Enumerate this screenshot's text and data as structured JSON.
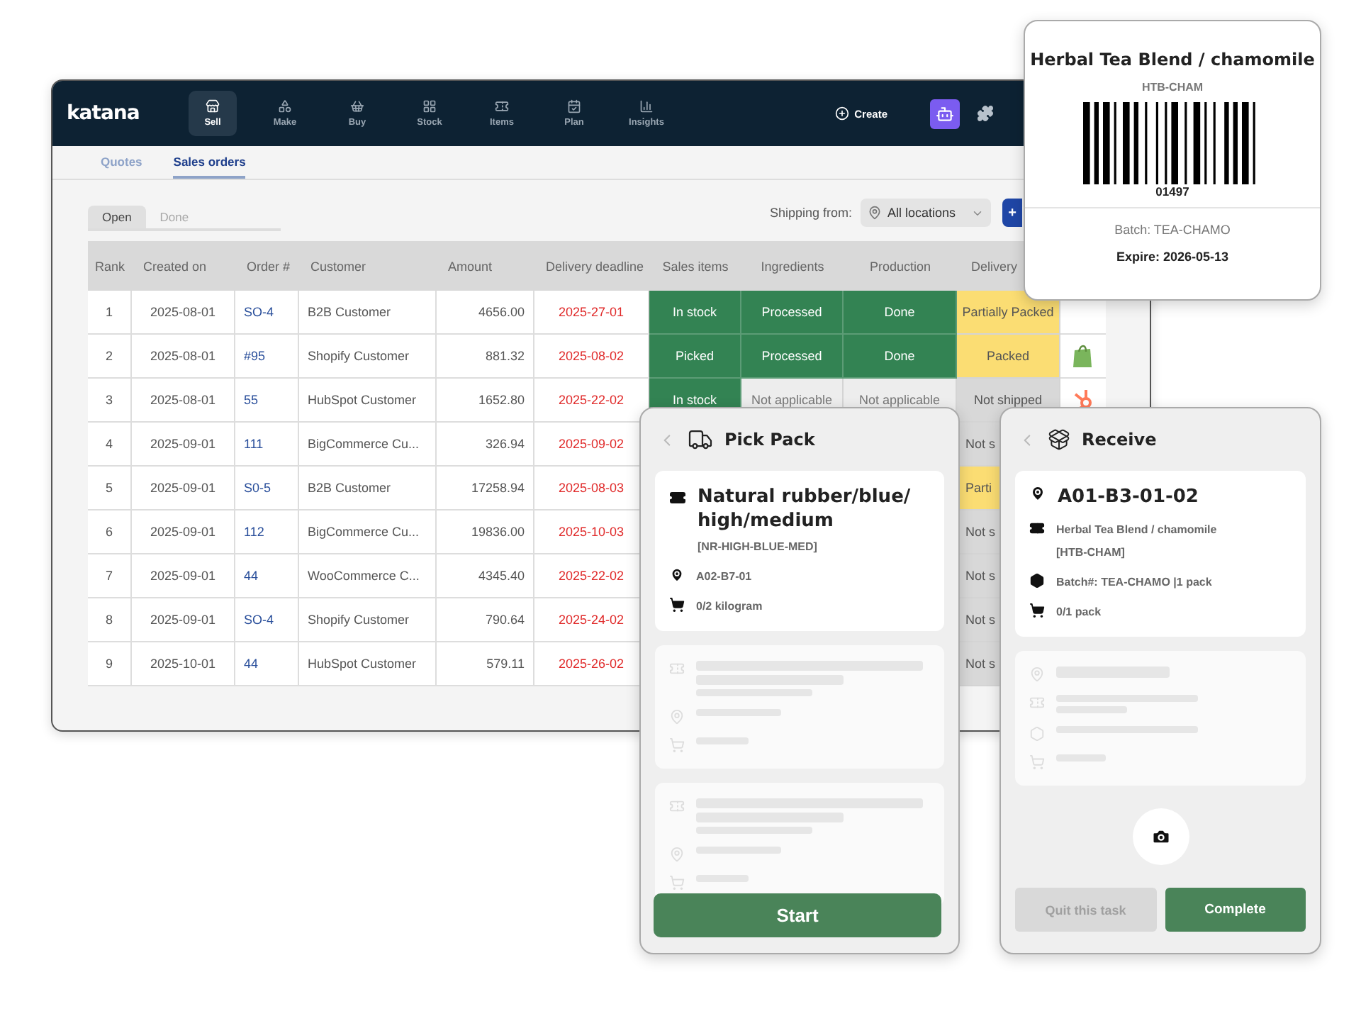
{
  "app": {
    "logo": "katana",
    "nav": [
      {
        "label": "Sell",
        "selected": true
      },
      {
        "label": "Make",
        "selected": false
      },
      {
        "label": "Buy",
        "selected": false
      },
      {
        "label": "Stock",
        "selected": false
      },
      {
        "label": "Items",
        "selected": false
      },
      {
        "label": "Plan",
        "selected": false
      },
      {
        "label": "Insights",
        "selected": false
      }
    ],
    "create": "Create"
  },
  "subtabs": [
    {
      "label": "Quotes",
      "selected": false
    },
    {
      "label": "Sales orders",
      "selected": true
    }
  ],
  "filters": [
    {
      "label": "Open",
      "selected": true
    },
    {
      "label": "Done",
      "selected": false
    }
  ],
  "shipping": {
    "label": "Shipping from:",
    "value": "All locations",
    "add": "+"
  },
  "table": {
    "columns": [
      "Rank",
      "Created on",
      "Order #",
      "Customer",
      "Amount",
      "Delivery deadline",
      "Sales items",
      "Ingredients",
      "Production",
      "Delivery"
    ],
    "rows": [
      {
        "cells": [
          "1",
          "2025-08-01",
          "SO-4",
          "B2B Customer",
          "4656.00",
          "2025-27-01"
        ],
        "stages": [
          {
            "text": "In stock",
            "color": "#338353"
          },
          {
            "text": "Processed",
            "color": "#338353"
          },
          {
            "text": "Done",
            "color": "#338353"
          }
        ],
        "delivery": {
          "text": "Partially Packed",
          "color": "#fbdd73"
        }
      },
      {
        "cells": [
          "2",
          "2025-08-01",
          "#95",
          "Shopify Customer",
          "881.32",
          "2025-08-02"
        ],
        "stages": [
          {
            "text": "Picked",
            "color": "#338353"
          },
          {
            "text": "Processed",
            "color": "#338353"
          },
          {
            "text": "Done",
            "color": "#338353"
          }
        ],
        "delivery": {
          "text": "Packed",
          "color": "#fbdd73"
        },
        "channel": {
          "kind": "shopify"
        }
      },
      {
        "cells": [
          "3",
          "2025-08-01",
          "55",
          "HubSpot Customer",
          "1652.80",
          "2025-22-02"
        ],
        "stages": [
          {
            "text": "In stock",
            "color": "#338353"
          },
          {
            "text": "Not applicable",
            "color": "#ededed"
          },
          {
            "text": "Not applicable",
            "color": "#ededed"
          }
        ],
        "delivery": {
          "text": "Not shipped",
          "color": "#d8d8d8"
        },
        "channel": {
          "kind": "hubspot"
        }
      },
      {
        "cells": [
          "4",
          "2025-09-01",
          "111",
          "BigCommerce Cu...",
          "326.94",
          "2025-09-02"
        ],
        "delivery": {
          "text": "Not s",
          "color": "#d8d8d8"
        }
      },
      {
        "cells": [
          "5",
          "2025-09-01",
          "S0-5",
          "B2B Customer",
          "17258.94",
          "2025-08-03"
        ],
        "delivery": {
          "text": "Parti",
          "color": "#fbdd73"
        }
      },
      {
        "cells": [
          "6",
          "2025-09-01",
          "112",
          "BigCommerce Cu...",
          "19836.00",
          "2025-10-03"
        ],
        "delivery": {
          "text": "Not s",
          "color": "#d8d8d8"
        }
      },
      {
        "cells": [
          "7",
          "2025-09-01",
          "44",
          "WooCommerce C...",
          "4345.40",
          "2025-22-02"
        ],
        "delivery": {
          "text": "Not s",
          "color": "#d8d8d8"
        }
      },
      {
        "cells": [
          "8",
          "2025-09-01",
          "SO-4",
          "Shopify Customer",
          "790.64",
          "2025-24-02"
        ],
        "delivery": {
          "text": "Not s",
          "color": "#d8d8d8"
        }
      },
      {
        "cells": [
          "9",
          "2025-10-01",
          "44",
          "HubSpot Customer",
          "579.11",
          "2025-26-02"
        ],
        "delivery": {
          "text": "Not s",
          "color": "#d8d8d8"
        }
      }
    ]
  },
  "label_card": {
    "title": "Herbal Tea Blend / chamomile",
    "sku": "HTB-CHAM",
    "code": "01497",
    "batch": "Batch: TEA-CHAMO",
    "expire": "Expire: 2026-05-13"
  },
  "pick_pack": {
    "title": "Pick Pack",
    "item": {
      "name": "Natural rubber/blue/high/medium",
      "sku": "[NR-HIGH-BLUE-MED]",
      "location": "A02-B7-01",
      "quantity": "0/2 kilogram"
    },
    "start": "Start"
  },
  "receive": {
    "title": "Receive",
    "item": {
      "location": "A01-B3-01-02",
      "name": "Herbal Tea Blend / chamomile",
      "sku": "[HTB-CHAM]",
      "batch": "Batch#: TEA-CHAMO |1 pack",
      "quantity": "0/1 pack"
    },
    "quit": {
      "label": "Quit this task",
      "disabled": true
    },
    "complete": "Complete"
  }
}
